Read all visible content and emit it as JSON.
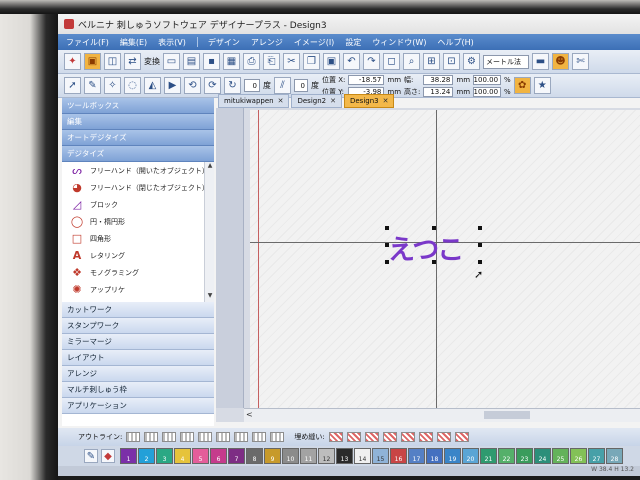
{
  "window": {
    "title": "ベルニナ 刺しゅうソフトウェア デザイナープラス - Design3"
  },
  "menubar": {
    "items": [
      "ファイル(F)",
      "編集(E)",
      "表示(V)",
      "デザイン",
      "アレンジ",
      "イメージ(I)",
      "設定",
      "ウィンドウ(W)",
      "ヘルプ(H)"
    ]
  },
  "toolbar1": {
    "convert_label": "変換",
    "unit_select": "メートル法"
  },
  "toolbar2": {
    "rotation_value": "0",
    "degree_label": "度",
    "slant_value": "0",
    "degree_label2": "度",
    "pos_x_label": "位置 X:",
    "pos_x_value": "-18.57",
    "pos_y_label": "位置 Y:",
    "pos_y_value": "-3.98",
    "unit_mm": "mm",
    "width_label": "幅:",
    "width_value": "38.28",
    "height_label": "高さ:",
    "height_value": "13.24",
    "scale_x": "100.00",
    "scale_y": "100.00",
    "percent": "%"
  },
  "tabs": [
    {
      "label": "mitukiwappen",
      "active": false
    },
    {
      "label": "Design2",
      "active": false
    },
    {
      "label": "Design3",
      "active": true
    }
  ],
  "leftpanel": {
    "toolbox_header": "ツールボックス",
    "edit_header": "編集",
    "autodigitize_header": "オートデジタイズ",
    "digitize_header": "デジタイズ",
    "tools": [
      {
        "label": "フリーハンド（開いたオブジェクト）",
        "icon": "freehand-open-icon"
      },
      {
        "label": "フリーハンド（閉じたオブジェクト）",
        "icon": "freehand-closed-icon"
      },
      {
        "label": "ブロック",
        "icon": "block-icon"
      },
      {
        "label": "円・楕円形",
        "icon": "circle-icon"
      },
      {
        "label": "四角形",
        "icon": "rectangle-icon"
      },
      {
        "label": "レタリング",
        "icon": "lettering-icon"
      },
      {
        "label": "モノグラミング",
        "icon": "monogram-icon"
      },
      {
        "label": "アップリケ",
        "icon": "applique-icon"
      }
    ],
    "sections": [
      "カットワーク",
      "スタンプワーク",
      "ミラーマージ",
      "レイアウト",
      "アレンジ",
      "マルチ刺しゅう枠",
      "アプリケーション"
    ]
  },
  "canvas": {
    "embroidery_text": "えつこ",
    "embroidery_color": "#7a38c9"
  },
  "outline": {
    "outline_label": "アウトライン:",
    "fill_label": "埋め縫い:"
  },
  "palette": {
    "swatches": [
      {
        "num": "1",
        "color": "#7b2fa8"
      },
      {
        "num": "2",
        "color": "#23a0d8"
      },
      {
        "num": "3",
        "color": "#2aa884"
      },
      {
        "num": "4",
        "color": "#e6c33a"
      },
      {
        "num": "5",
        "color": "#e45d9a"
      },
      {
        "num": "6",
        "color": "#c53b8c"
      },
      {
        "num": "7",
        "color": "#7d2d84"
      },
      {
        "num": "8",
        "color": "#6a6a6a"
      },
      {
        "num": "9",
        "color": "#c79a2b"
      },
      {
        "num": "10",
        "color": "#8b8b8b"
      },
      {
        "num": "11",
        "color": "#a3a3a3"
      },
      {
        "num": "12",
        "color": "#bdbdbd"
      },
      {
        "num": "13",
        "color": "#2a2a2a"
      },
      {
        "num": "14",
        "color": "#f0f0f0"
      },
      {
        "num": "15",
        "color": "#8fb3d8"
      },
      {
        "num": "16",
        "color": "#c84545"
      },
      {
        "num": "17",
        "color": "#5580c5"
      },
      {
        "num": "18",
        "color": "#4470c0"
      },
      {
        "num": "19",
        "color": "#3a85c8"
      },
      {
        "num": "20",
        "color": "#5aa5d5"
      },
      {
        "num": "21",
        "color": "#2f9a6f"
      },
      {
        "num": "22",
        "color": "#55b06a"
      },
      {
        "num": "23",
        "color": "#3a9c5c"
      },
      {
        "num": "24",
        "color": "#2c8f7a"
      },
      {
        "num": "25",
        "color": "#64b25a"
      },
      {
        "num": "26",
        "color": "#83c157"
      },
      {
        "num": "27",
        "color": "#47a0a8"
      },
      {
        "num": "28",
        "color": "#78a8b8"
      },
      {
        "num": "29",
        "color": "#a0b0c0"
      },
      {
        "num": "30",
        "color": "#c8c8c8"
      }
    ]
  },
  "status": {
    "text": "W  38.4  H  13.2"
  }
}
